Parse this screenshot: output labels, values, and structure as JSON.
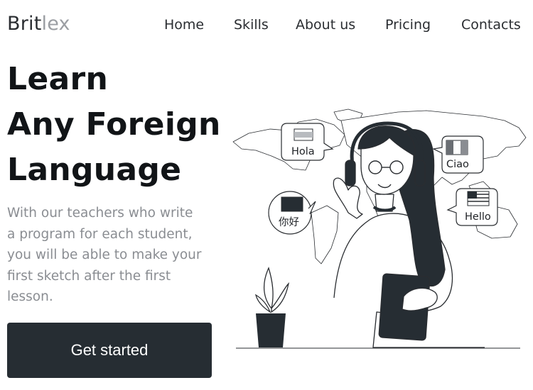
{
  "header": {
    "logo_part1": "Brit",
    "logo_part2": "lex",
    "nav": [
      {
        "label": "Home"
      },
      {
        "label": "Skills"
      },
      {
        "label": "About us"
      },
      {
        "label": "Pricing"
      },
      {
        "label": "Contacts"
      }
    ]
  },
  "hero": {
    "title_lines": [
      "Learn",
      "Any Foreign",
      "Language"
    ],
    "description_lines": [
      "With our teachers who write",
      "a program for each student,",
      "you will be able to make your",
      "first sketch after the first",
      "lesson."
    ],
    "cta_label": "Get started"
  },
  "illustration": {
    "greetings": [
      "Hola",
      "Ciao",
      "你好",
      "Hello"
    ],
    "colors": {
      "ink": "#262d33",
      "line": "#2a2d31",
      "paper": "#ffffff"
    }
  }
}
